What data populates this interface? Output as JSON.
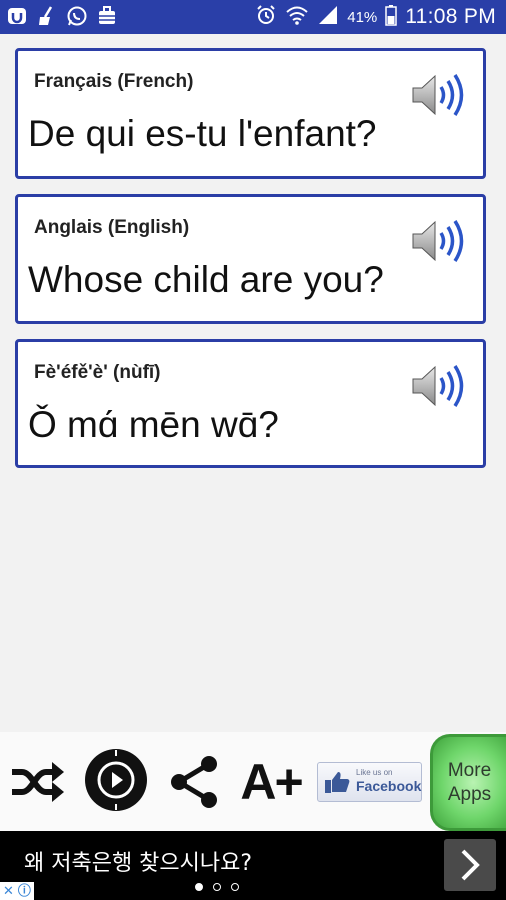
{
  "status_bar": {
    "battery_percent": "41%",
    "time": "11:08 PM",
    "background_color": "#2a3fa8",
    "left_icons": [
      "clean-app-icon",
      "broom-icon",
      "whatsapp-icon",
      "briefcase-icon"
    ],
    "right_icons": [
      "alarm-icon",
      "wifi-icon",
      "signal-icon",
      "battery-icon"
    ]
  },
  "cards": [
    {
      "language": "Français (French)",
      "phrase": "De qui es-tu l'enfant?",
      "speaker_icon": "speaker-icon"
    },
    {
      "language": "Anglais (English)",
      "phrase": "Whose child are you?",
      "speaker_icon": "speaker-icon"
    },
    {
      "language": "Fè'éfě'è' (nùfī)",
      "phrase": "Ǒ mɑ́ mēn wɑ̄?",
      "speaker_icon": "speaker-icon"
    }
  ],
  "card_border_color": "#2b3ea6",
  "toolbar": {
    "icons": [
      "shuffle-icon",
      "play-icon",
      "share-icon",
      "font-size-icon"
    ],
    "font_size_label": "A+",
    "facebook_small": "Like us on",
    "facebook_big": "Facebook",
    "more_apps_line1": "More",
    "more_apps_line2": "Apps"
  },
  "ad": {
    "text": "왜 저축은행 찾으시나요?",
    "page_count": 3,
    "active_page": 1,
    "corner_icons": [
      "close-icon",
      "info-icon"
    ],
    "arrow_icon": "chevron-right-icon"
  }
}
